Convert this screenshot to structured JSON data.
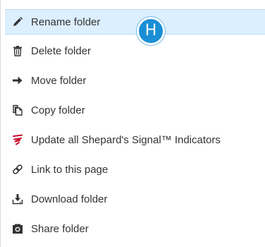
{
  "menu": {
    "items": [
      {
        "label": "Rename folder",
        "icon": "pencil-icon"
      },
      {
        "label": "Delete folder",
        "icon": "trash-icon"
      },
      {
        "label": "Move folder",
        "icon": "arrow-right-icon"
      },
      {
        "label": "Copy folder",
        "icon": "copy-icon"
      },
      {
        "label": "Update all Shepard's Signal™ Indicators",
        "icon": "shepards-signal-icon"
      },
      {
        "label": "Link to this page",
        "icon": "link-icon"
      },
      {
        "label": "Download folder",
        "icon": "download-icon"
      },
      {
        "label": "Share folder",
        "icon": "share-icon"
      }
    ]
  },
  "badge": {
    "letter": "H",
    "color": "#1a8fd6"
  },
  "colors": {
    "highlight": "#dcefff",
    "text": "#333333",
    "signal_red": "#c8102e"
  }
}
